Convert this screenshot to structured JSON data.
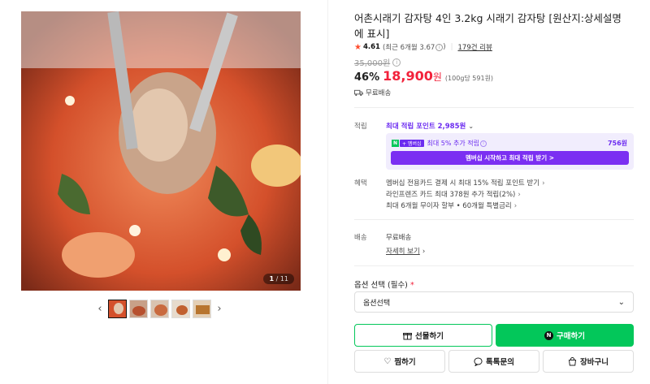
{
  "gallery": {
    "counter_current": "1",
    "counter_separator": "/",
    "counter_total": "11",
    "prev_icon": "chevron-left-icon",
    "next_icon": "chevron-right-icon",
    "thumbnail_count": 5
  },
  "product": {
    "title": "어촌시래기 감자탕 4인 3.2kg 시래기 감자탕 [원산지:상세설명에 표시]",
    "rating_score": "4.61",
    "rating_recent": "(최근 6개월 3.67",
    "rating_recent_close": ")",
    "review_count": "179건 리뷰",
    "original_price": "35,000원",
    "discount": "46%",
    "price": "18,900",
    "price_unit": "원",
    "unit_price": "(100g당 591원)",
    "shipping_short": "무료배송"
  },
  "points": {
    "label": "적립",
    "headline": "최대 적립 포인트 2,985원",
    "member_badge_n": "N",
    "member_badge_plus": "+ 멤버십",
    "member_text": "최대 5% 추가 적립",
    "member_amount": "756원",
    "member_button": "멤버십 시작하고 최대 적립 받기 >"
  },
  "benefits": {
    "label": "혜택",
    "items": [
      "멤버십 전용카드 결제 시 최대 15% 적립 포인트 받기",
      "라인프렌즈 카드 최대 378원 추가 적립(2%)",
      "최대 6개월 무이자 할부 • 60개월 특별금리"
    ]
  },
  "delivery": {
    "label": "배송",
    "value": "무료배송",
    "detail_link": "자세히 보기"
  },
  "options": {
    "label": "옵션 선택 (필수)",
    "required_mark": "*",
    "select_value": "옵션선택"
  },
  "actions": {
    "gift": "선물하기",
    "buy": "구매하기",
    "buy_badge": "N",
    "wish": "찜하기",
    "talk": "톡톡문의",
    "cart": "장바구니"
  },
  "colors": {
    "accent_green": "#03c75a",
    "price_red": "#f2223b",
    "membership_purple": "#7b2ff2"
  }
}
